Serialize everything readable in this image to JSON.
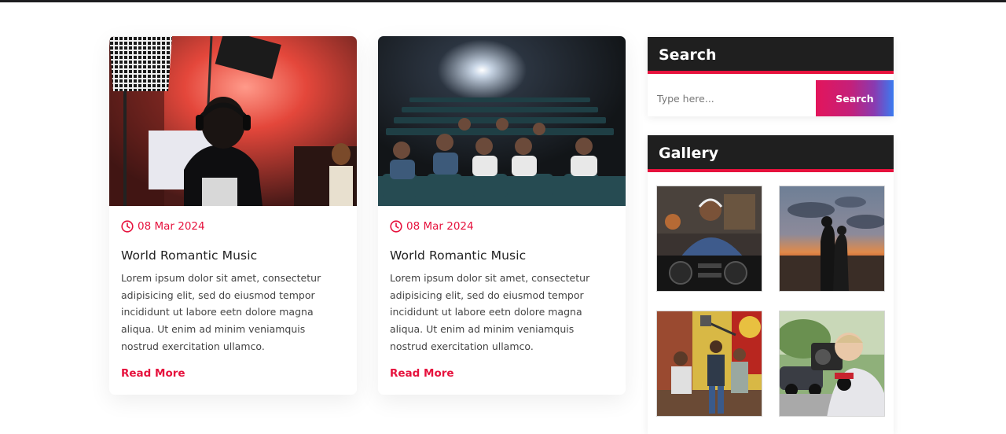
{
  "posts": [
    {
      "date": "08 Mar 2024",
      "title": "World Romantic Music",
      "excerpt": "Lorem ipsum dolor sit amet, consectetur adipisicing elit, sed do eiusmod tempor incididunt ut labore eetn dolore magna aliqua. Ut enim ad minim veniamquis nostrud exercitation ullamco.",
      "read_more": "Read More",
      "image": "recording-studio-photo"
    },
    {
      "date": "08 Mar 2024",
      "title": "World Romantic Music",
      "excerpt": "Lorem ipsum dolor sit amet, consectetur adipisicing elit, sed do eiusmod tempor incididunt ut labore eetn dolore magna aliqua. Ut enim ad minim veniamquis nostrud exercitation ullamco.",
      "read_more": "Read More",
      "image": "cinema-audience-photo"
    }
  ],
  "sidebar": {
    "search": {
      "title": "Search",
      "placeholder": "Type here...",
      "button_label": "Search"
    },
    "gallery": {
      "title": "Gallery",
      "images": [
        "dj-mixing-photo",
        "sunset-couple-photo",
        "film-crew-photo",
        "camera-operator-photo"
      ]
    }
  },
  "colors": {
    "accent": "#e6123d",
    "widget_header": "#1f1f1f",
    "button_gradient_start": "#e3155b",
    "button_gradient_end": "#3a7bf0"
  },
  "icons": {
    "date": "clock-icon"
  }
}
